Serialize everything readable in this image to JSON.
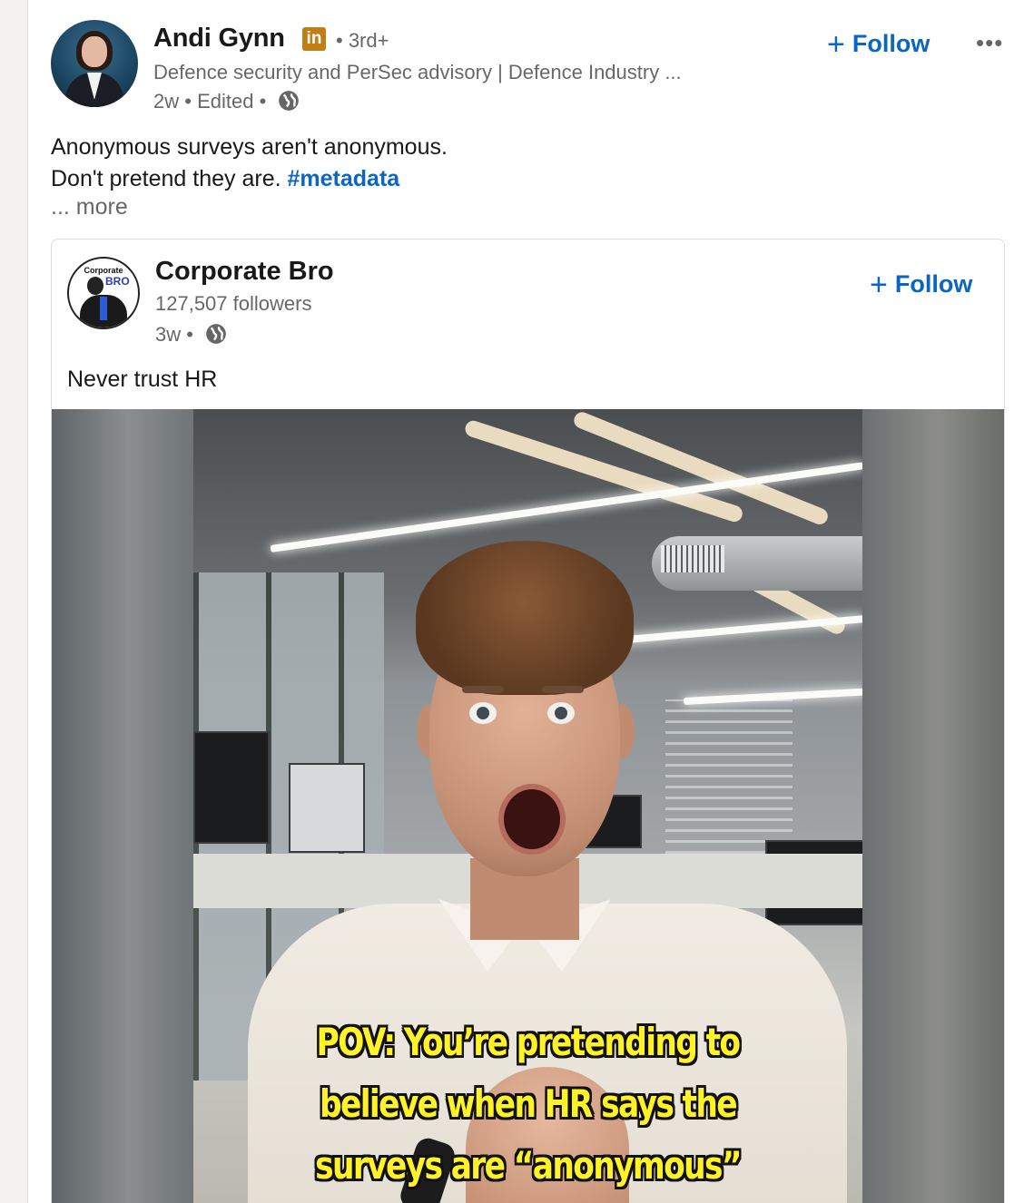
{
  "post": {
    "author": {
      "name": "Andi Gynn",
      "badge": "in",
      "degree": "• 3rd+",
      "headline": "Defence security and PerSec advisory | Defence Industry ...",
      "time": "2w",
      "edited": "Edited",
      "sep": "•",
      "visibility_icon": "globe-icon"
    },
    "follow_label": "Follow",
    "more_label": "•••",
    "text_line1": "Anonymous surveys aren't anonymous.",
    "text_line2": "Don't pretend they are.",
    "hashtag": "#metadata",
    "see_more": "... more"
  },
  "reshare": {
    "name": "Corporate Bro",
    "avatar_text_top": "Corporate",
    "avatar_text_bro": "BRO",
    "followers": "127,507 followers",
    "time": "3w",
    "sep": "•",
    "follow_label": "Follow",
    "text": "Never trust HR",
    "video": {
      "caption_line1": "POV: You’re pretending to",
      "caption_line2": "believe when HR says the",
      "caption_line3": "surveys are “anonymous”"
    }
  },
  "colors": {
    "link": "#0a66c2",
    "li_badge": "#c37d16",
    "caption": "#fff226"
  }
}
